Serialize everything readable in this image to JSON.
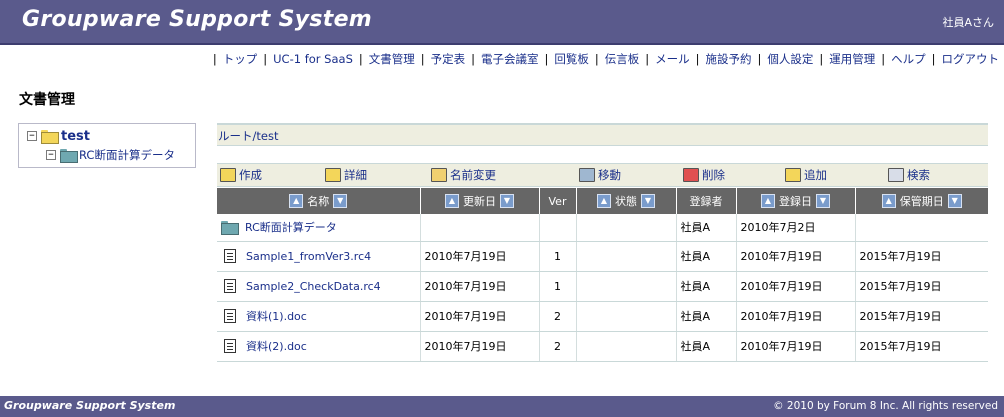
{
  "header": {
    "title": "Groupware Support System",
    "user": "社員Aさん"
  },
  "nav": [
    {
      "label": "トップ"
    },
    {
      "label": "UC-1 for SaaS"
    },
    {
      "label": "文書管理"
    },
    {
      "label": "予定表"
    },
    {
      "label": "電子会議室"
    },
    {
      "label": "回覧板"
    },
    {
      "label": "伝言板"
    },
    {
      "label": "メール"
    },
    {
      "label": "施設予約"
    },
    {
      "label": "個人設定"
    },
    {
      "label": "運用管理"
    },
    {
      "label": "ヘルプ"
    },
    {
      "label": "ログアウト"
    }
  ],
  "page": {
    "title": "文書管理"
  },
  "tree": {
    "root": {
      "label": "test",
      "toggle": "−"
    },
    "child": {
      "label": "RC断面計算データ",
      "toggle": "−"
    }
  },
  "path": "ルート/test",
  "toolbar": {
    "create": "作成",
    "detail": "詳細",
    "rename": "名前変更",
    "move": "移動",
    "delete": "削除",
    "add": "追加",
    "search": "検索"
  },
  "table": {
    "headers": {
      "name": "名称",
      "updated": "更新日",
      "ver": "Ver",
      "status": "状態",
      "registrant": "登録者",
      "registered": "登録日",
      "retention": "保管期日"
    },
    "rows": [
      {
        "type": "folder",
        "name": "RC断面計算データ",
        "updated": "",
        "ver": "",
        "status": "",
        "registrant": "社員A",
        "registered": "2010年7月2日",
        "retention": ""
      },
      {
        "type": "doc",
        "name": "Sample1_fromVer3.rc4",
        "updated": "2010年7月19日",
        "ver": "1",
        "status": "",
        "registrant": "社員A",
        "registered": "2010年7月19日",
        "retention": "2015年7月19日"
      },
      {
        "type": "doc",
        "name": "Sample2_CheckData.rc4",
        "updated": "2010年7月19日",
        "ver": "1",
        "status": "",
        "registrant": "社員A",
        "registered": "2010年7月19日",
        "retention": "2015年7月19日"
      },
      {
        "type": "doc",
        "name": "資料(1).doc",
        "updated": "2010年7月19日",
        "ver": "2",
        "status": "",
        "registrant": "社員A",
        "registered": "2010年7月19日",
        "retention": "2015年7月19日"
      },
      {
        "type": "doc",
        "name": "資料(2).doc",
        "updated": "2010年7月19日",
        "ver": "2",
        "status": "",
        "registrant": "社員A",
        "registered": "2010年7月19日",
        "retention": "2015年7月19日"
      }
    ]
  },
  "footer": {
    "title": "Groupware Support System",
    "copyright": "© 2010 by Forum 8 Inc. All rights reserved"
  },
  "colors": {
    "header_bg": "#5a5a8c",
    "link": "#1a2f8a",
    "grid_header": "#666666",
    "bar_bg": "#eeeee0"
  }
}
